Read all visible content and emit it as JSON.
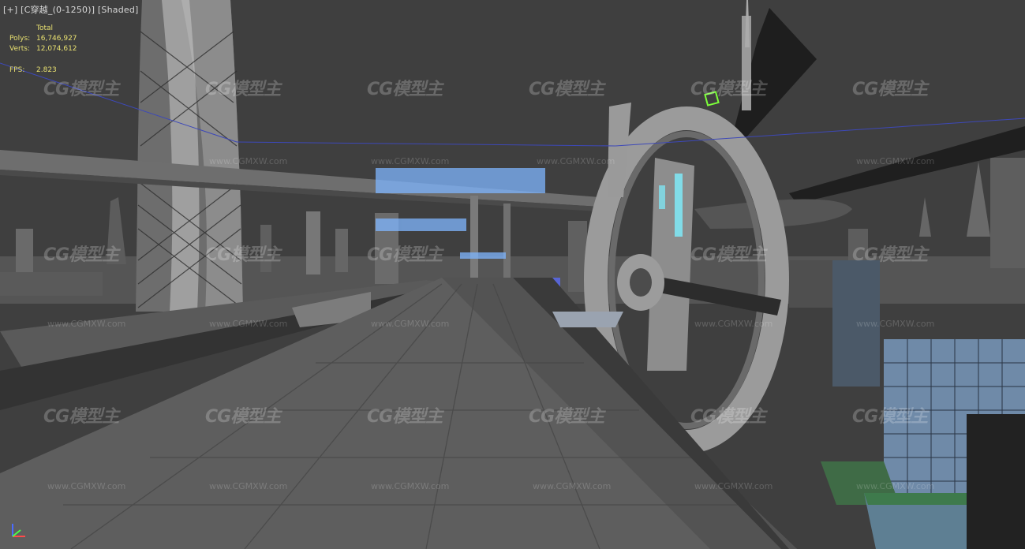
{
  "viewport": {
    "label": "[+] [C穿越_(0-1250)] [Shaded]"
  },
  "stats": {
    "total_label": "Total",
    "polys_label": "Polys:",
    "polys_value": "16,746,927",
    "verts_label": "Verts:",
    "verts_value": "12,074,612",
    "fps_label": "FPS:",
    "fps_value": "2.823"
  },
  "watermark": {
    "logo_text": "CG模型主",
    "url_text": "www.CGMXW.com"
  },
  "colors": {
    "background": "#3f3f3f",
    "stats_text": "#e8e070",
    "selection_box": "#7cff3a",
    "blue_panel": "#7fb6ff"
  }
}
